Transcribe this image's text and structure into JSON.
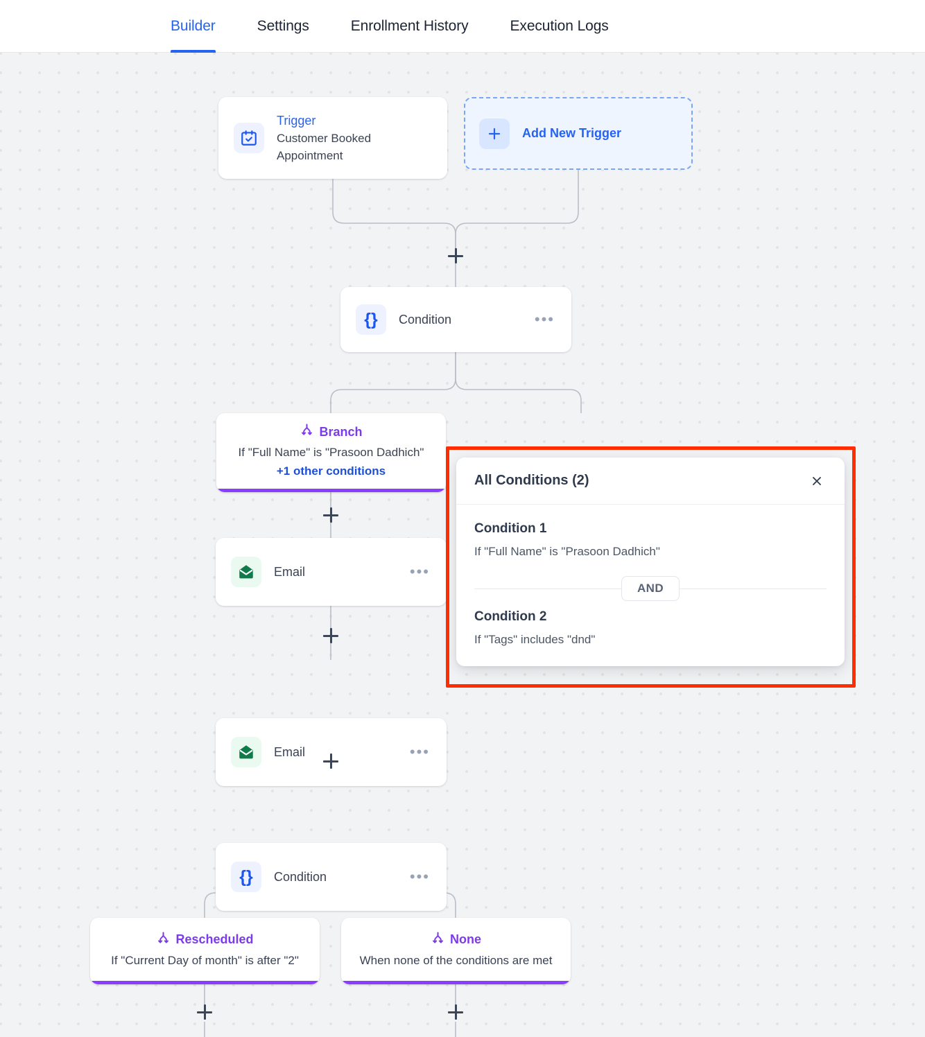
{
  "tabs": [
    {
      "label": "Builder",
      "active": true
    },
    {
      "label": "Settings",
      "active": false
    },
    {
      "label": "Enrollment History",
      "active": false
    },
    {
      "label": "Execution Logs",
      "active": false
    }
  ],
  "nodes": {
    "trigger": {
      "icon": "calendar-check-icon",
      "label": "Trigger",
      "name": "Customer Booked Appointment"
    },
    "add_trigger": {
      "icon": "plus-icon",
      "label": "Add New Trigger"
    },
    "condition_top": {
      "icon": "curly-braces-icon",
      "label": "Condition",
      "menu": "•••"
    },
    "branch_main": {
      "icon": "branch-icon",
      "title": "Branch",
      "description": "If \"Full Name\" is \"Prasoon Dadhich\"",
      "more_link": "+1 other conditions"
    },
    "email_1": {
      "icon": "envelope-icon",
      "label": "Email",
      "menu": "•••"
    },
    "email_2": {
      "icon": "envelope-icon",
      "label": "Email",
      "menu": "•••"
    },
    "condition_bottom": {
      "icon": "curly-braces-icon",
      "label": "Condition",
      "menu": "•••"
    },
    "branch_rescheduled": {
      "icon": "branch-icon",
      "title": "Rescheduled",
      "description": "If \"Current Day of month\" is after \"2\""
    },
    "branch_none": {
      "icon": "branch-icon",
      "title": "None",
      "description": "When none of the conditions are met"
    }
  },
  "popup": {
    "title": "All Conditions (2)",
    "close_icon": "close-icon",
    "operator": "AND",
    "conditions": [
      {
        "title": "Condition 1",
        "text": "If \"Full Name\" is \"Prasoon Dadhich\""
      },
      {
        "title": "Condition 2",
        "text": "If \"Tags\" includes \"dnd\""
      }
    ]
  },
  "colors": {
    "accent_blue": "#2563f0",
    "branch_purple": "#8b3dff",
    "email_green": "#0f7a4a",
    "highlight_red": "#ff2d00"
  }
}
